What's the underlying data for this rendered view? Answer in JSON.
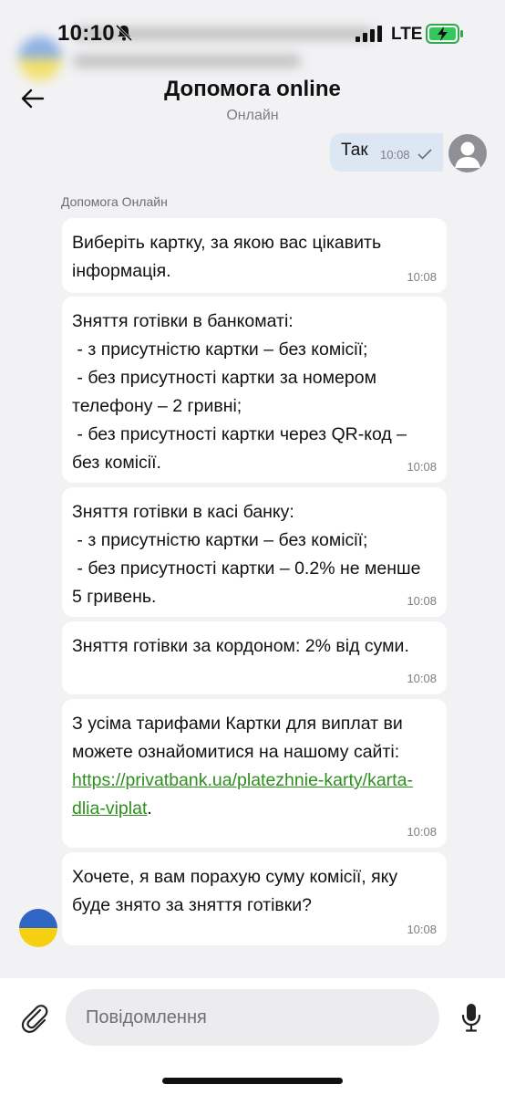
{
  "status": {
    "time": "10:10",
    "network": "LTE",
    "icons": [
      "bell-slash-icon",
      "signal-icon",
      "battery-charging-icon"
    ]
  },
  "header": {
    "title": "Допомога online",
    "subtitle": "Онлайн",
    "back_icon": "arrow-left-icon"
  },
  "outgoing": {
    "text": "Так",
    "time": "10:08",
    "status_icon": "check-icon"
  },
  "sender_name": "Допомога Онлайн",
  "messages": [
    {
      "text": "Виберіть картку, за якою вас цікавить інформація.",
      "time": "10:08"
    },
    {
      "text": "Зняття готівки в банкоматі:\n - з присутністю картки – без комісії;\n - без присутності картки за номером телефону – 2 гривні;\n - без присутності картки через QR-код – без комісії.",
      "time": "10:08"
    },
    {
      "text": "Зняття готівки в касі банку:\n - з присутністю картки – без комісії;\n - без присутності картки – 0.2% не менше 5 гривень.",
      "time": "10:08"
    },
    {
      "text": "Зняття готівки за кордоном: 2% від суми.",
      "time": "10:08"
    },
    {
      "text_before": "З усіма тарифами Картки для виплат ви можете ознайомитися на нашому сайті:",
      "link": "https://privatbank.ua/platezhnie-karty/karta-dlia-viplat",
      "text_after": ".",
      "time": "10:08"
    },
    {
      "text": "Хочете, я вам порахую суму комісії, яку буде знято за зняття готівки?",
      "time": "10:08"
    }
  ],
  "composer": {
    "placeholder": "Повідомлення",
    "attach_icon": "paperclip-icon",
    "mic_icon": "microphone-icon"
  },
  "colors": {
    "background": "#f2f2f4",
    "outgoing_bubble": "#dde7f3",
    "link": "#2e8f1f"
  }
}
